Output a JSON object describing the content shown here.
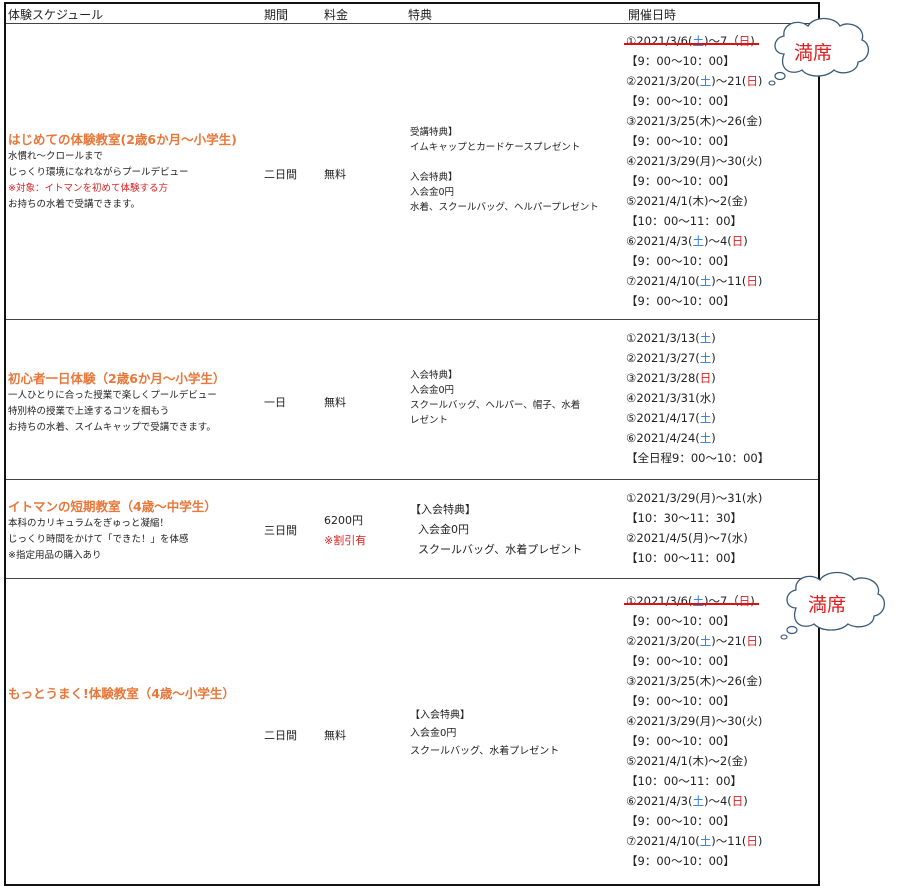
{
  "headers": {
    "schedule": "体験スケジュール",
    "period": "期間",
    "fee": "料金",
    "benefit": "特典",
    "datetime": "開催日時"
  },
  "bubbles": [
    {
      "text": "満席"
    },
    {
      "text": "満席"
    }
  ],
  "rows": [
    {
      "title": "はじめての体験教室(2歳6か月～小学生)",
      "desc": [
        "水慣れ～クロールまで",
        "じっくり環境になれながらプールデビュー",
        "※対象：イトマンを初めて体験する方",
        "お持ちの水着で受講できます。"
      ],
      "period": "二日間",
      "fee": "無料",
      "fee_note": "",
      "benefits": [
        "受講特典】",
        "イムキャップとカードケースプレゼント",
        "",
        "入会特典】",
        "入会金0円",
        "水着、スクールバッグ、ヘルパープレゼント"
      ],
      "schedule": [
        {
          "num": "①",
          "date": "2021/3/6(",
          "d1": "土",
          "mid": ")～7（",
          "d2": "日",
          "end": ")",
          "full": true
        },
        {
          "time": "【9：00～10：00】"
        },
        {
          "num": "②",
          "date": "2021/3/20(",
          "d1": "土",
          "mid": ")～21(",
          "d2": "日",
          "end": ")"
        },
        {
          "time": "【9：00～10：00】"
        },
        {
          "num": "③",
          "date": "2021/3/25(木)～26(金)"
        },
        {
          "time": "【9：00～10：00】"
        },
        {
          "num": "④",
          "date": "2021/3/29(月)～30(火)"
        },
        {
          "time": "【9：00～10：00】"
        },
        {
          "num": "⑤",
          "date": "2021/4/1(木)～2(金)"
        },
        {
          "time": "【10：00～11：00】"
        },
        {
          "num": "⑥",
          "date": "2021/4/3(",
          "d1": "土",
          "mid": ")～4(",
          "d2": "日",
          "end": ")"
        },
        {
          "time": "【9：00～10：00】"
        },
        {
          "num": "⑦",
          "date": "2021/4/10(",
          "d1": "土",
          "mid": ")～11(",
          "d2": "日",
          "end": ")"
        },
        {
          "time": "【9：00～10：00】"
        }
      ]
    },
    {
      "title": "初心者一日体験（2歳6か月～小学生）",
      "desc": [
        "一人ひとりに合った授業で楽しくプールデビュー",
        "特別枠の授業で上達するコツを掴もう",
        "お持ちの水着、スイムキャップで受講できます。"
      ],
      "period": "一日",
      "fee": "無料",
      "fee_note": "",
      "benefits": [
        "入会特典】",
        "入会金0円",
        "スクールバッグ、ヘルパー、帽子、水着",
        "レゼント"
      ],
      "schedule": [
        {
          "num": "①",
          "date": "2021/3/13(",
          "d1": "土",
          "end": ")"
        },
        {
          "num": "②",
          "date": "2021/3/27(",
          "d1": "土",
          "end": ")"
        },
        {
          "num": "③",
          "date": "2021/3/28(",
          "d2": "日",
          "end": ")"
        },
        {
          "num": "④",
          "date": "2021/3/31(水)"
        },
        {
          "num": "⑤",
          "date": "2021/4/17(",
          "d1": "土",
          "end": ")"
        },
        {
          "num": "⑥",
          "date": "2021/4/24(",
          "d1": "土",
          "end": ")"
        },
        {
          "time": "【全日程9：00～10：00】"
        }
      ]
    },
    {
      "title": "イトマンの短期教室（4歳～中学生）",
      "desc": [
        "本科のカリキュラムをぎゅっと凝縮！",
        "じっくり時間をかけて「できた！」を体感",
        "※指定用品の購入あり"
      ],
      "period": "三日間",
      "fee": "6200円",
      "fee_note": "※割引有",
      "benefits": [
        "【入会特典】",
        "入会金0円",
        "スクールバッグ、水着プレゼント"
      ],
      "schedule": [
        {
          "num": "①",
          "date": "2021/3/29(月)～31(水)"
        },
        {
          "time": "【10：30～11：30】"
        },
        {
          "num": "②",
          "date": "2021/4/5(月)～7(水)"
        },
        {
          "time": "【10：00～11：00】"
        }
      ]
    },
    {
      "title": "もっとうまく!体験教室（4歳～小学生）",
      "desc": [],
      "period": "二日間",
      "fee": "無料",
      "fee_note": "",
      "benefits": [
        "【入会特典】",
        "入会金0円",
        "スクールバッグ、水着プレゼント"
      ],
      "schedule": [
        {
          "num": "①",
          "date": "2021/3/6(",
          "d1": "土",
          "mid": ")～7（",
          "d2": "日",
          "end": ")",
          "full": true
        },
        {
          "time": "【9：00～10：00】"
        },
        {
          "num": "②",
          "date": "2021/3/20(",
          "d1": "土",
          "mid": ")～21(",
          "d2": "日",
          "end": ")"
        },
        {
          "time": "【9：00～10：00】"
        },
        {
          "num": "③",
          "date": "2021/3/25(木)～26(金)"
        },
        {
          "time": "【9：00～10：00】"
        },
        {
          "num": "④",
          "date": "2021/3/29(月)～30(火)"
        },
        {
          "time": "【9：00～10：00】"
        },
        {
          "num": "⑤",
          "date": "2021/4/1(木)～2(金)"
        },
        {
          "time": "【10：00～11：00】"
        },
        {
          "num": "⑥",
          "date": "2021/4/3(",
          "d1": "土",
          "mid": ")～4(",
          "d2": "日",
          "end": ")"
        },
        {
          "time": "【9：00～10：00】"
        },
        {
          "num": "⑦",
          "date": "2021/4/10(",
          "d1": "土",
          "mid": ")～11(",
          "d2": "日",
          "end": ")"
        },
        {
          "time": "【9：00～10：00】"
        }
      ]
    }
  ]
}
